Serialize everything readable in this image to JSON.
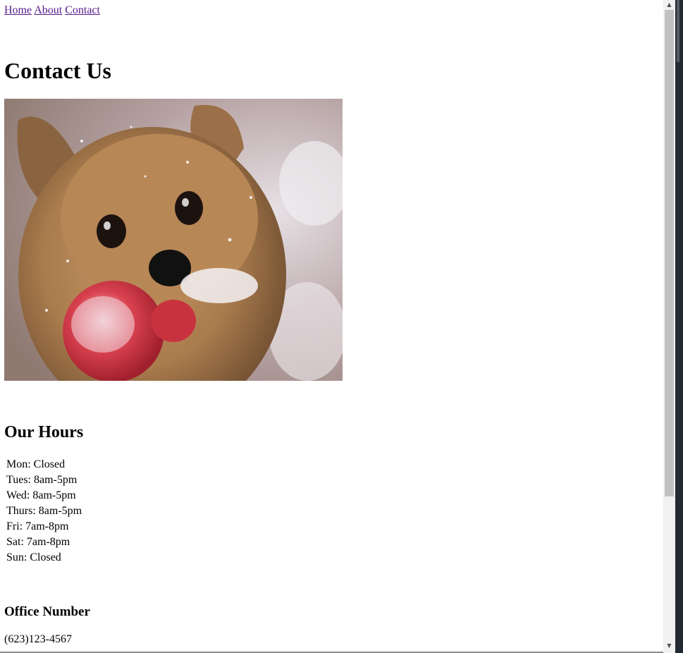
{
  "nav": {
    "links": [
      "Home",
      "About",
      "Contact"
    ]
  },
  "page": {
    "title": "Contact Us"
  },
  "hours": {
    "heading": "Our Hours",
    "items": [
      "Mon: Closed",
      "Tues: 8am-5pm",
      "Wed: 8am-5pm",
      "Thurs: 8am-5pm",
      "Fri: 7am-8pm",
      "Sat: 7am-8pm",
      "Sun: Closed"
    ]
  },
  "office": {
    "heading": "Office Number",
    "phone": "(623)123-4567"
  },
  "scrollbar": {
    "up_icon": "arrow-up-icon",
    "down_icon": "arrow-down-icon"
  },
  "colors": {
    "link_visited": "#551a8b",
    "scrollbar_track": "#f1f1f1",
    "scrollbar_thumb": "#c1c1c1"
  }
}
